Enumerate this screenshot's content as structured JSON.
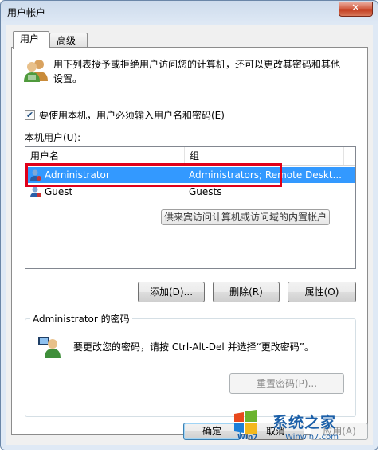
{
  "window": {
    "title": "用户帐户",
    "close_glyph": "✕"
  },
  "tabs": [
    {
      "label": "用户"
    },
    {
      "label": "高级"
    }
  ],
  "description": "用下列表授予或拒绝用户访问您的计算机，还可以更改其密码和其他设置。",
  "must_login_checkbox": {
    "checked": true,
    "label": "要使用本机，用户必须输入用户名和密码(E)"
  },
  "local_users_label": "本机用户(U):",
  "user_list": {
    "columns": [
      "用户名",
      "组"
    ],
    "rows": [
      {
        "name": "Administrator",
        "group": "Administrators; Remote Deskt...",
        "selected": true
      },
      {
        "name": "Guest",
        "group": "Guests",
        "selected": false
      }
    ],
    "tooltip": "供来宾访问计算机或访问域的内置帐户"
  },
  "actions": {
    "add": "添加(D)...",
    "remove": "删除(R)",
    "properties": "属性(O)"
  },
  "password_group": {
    "title": "Administrator 的密码",
    "text": "要更改您的密码，请按 Ctrl-Alt-Del 并选择“更改密码”。",
    "reset_button": "重置密码(P)..."
  },
  "dialog_buttons": {
    "ok": "确定",
    "cancel": "取消",
    "apply": "应用(A)"
  },
  "watermark": {
    "brand": "系统之家",
    "logo_letters": "Win7",
    "url": "Winwin7.com"
  },
  "colors": {
    "selection": "#3399ff",
    "highlight_box": "#e0001a",
    "watermark": "#1b5fa8"
  }
}
